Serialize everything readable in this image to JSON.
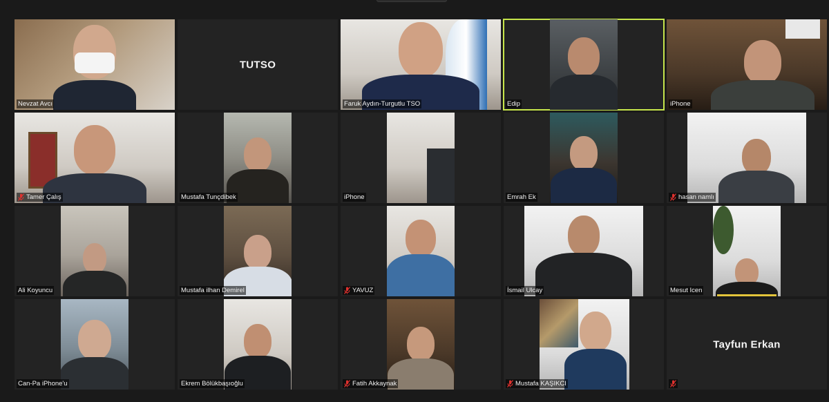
{
  "meeting": {
    "tiles": [
      {
        "name": "Nevzat Avcı",
        "muted": false
      },
      {
        "name": "TUTSO",
        "muted": false,
        "no_video": true,
        "big_label": "TUTSO",
        "hide_name": true
      },
      {
        "name": "Faruk Aydın-Turgutlu TSO",
        "muted": false
      },
      {
        "name": "Edip",
        "muted": false,
        "active_speaker": true
      },
      {
        "name": "iPhone",
        "muted": false
      },
      {
        "name": "Tamer Çalış",
        "muted": true
      },
      {
        "name": "Mustafa Tunçdibek",
        "muted": false
      },
      {
        "name": "iPhone",
        "muted": false
      },
      {
        "name": "Emrah Ek",
        "muted": false
      },
      {
        "name": "hasan namlı",
        "muted": true
      },
      {
        "name": "Ali Koyuncu",
        "muted": false
      },
      {
        "name": "Mustafa ilhan Demirel",
        "muted": false
      },
      {
        "name": "YAVUZ",
        "muted": true
      },
      {
        "name": "İsmail Ulcay",
        "muted": false
      },
      {
        "name": "Mesut Icen",
        "muted": false
      },
      {
        "name": "Can-Pa iPhone'u",
        "muted": false
      },
      {
        "name": "Ekrem Bölükbaşıoğlu",
        "muted": false
      },
      {
        "name": "Fatih Akkaynak",
        "muted": true
      },
      {
        "name": "Mustafa KAŞIKCI",
        "muted": true
      },
      {
        "name": "",
        "muted": true,
        "no_video": true,
        "big_label": "Tayfun Erkan"
      }
    ]
  },
  "icons": {
    "muted": "mic-muted-icon"
  },
  "colors": {
    "active_speaker_border": "#c7e64b",
    "muted_icon": "#e0312e",
    "background": "#1a1a1a",
    "tile_background": "#232323"
  }
}
